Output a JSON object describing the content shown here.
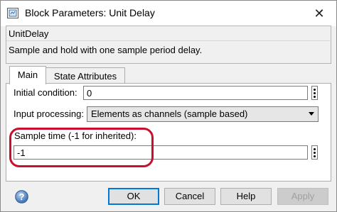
{
  "window": {
    "title": "Block Parameters: Unit Delay",
    "close_glyph": "✕"
  },
  "header": {
    "block_name": "UnitDelay",
    "description": "Sample and hold with one sample period delay."
  },
  "tabs": [
    {
      "label": "Main",
      "active": true
    },
    {
      "label": "State Attributes",
      "active": false
    }
  ],
  "main": {
    "initial_condition": {
      "label": "Initial condition:",
      "value": "0"
    },
    "input_processing": {
      "label": "Input processing:",
      "value": "Elements as channels (sample based)"
    },
    "sample_time": {
      "label": "Sample time (-1 for inherited):",
      "value": "-1"
    }
  },
  "annotation": {
    "highlight_color": "#c8102e"
  },
  "footer": {
    "help_icon": "question-icon",
    "buttons": {
      "ok": "OK",
      "cancel": "Cancel",
      "help": "Help",
      "apply": "Apply"
    }
  }
}
